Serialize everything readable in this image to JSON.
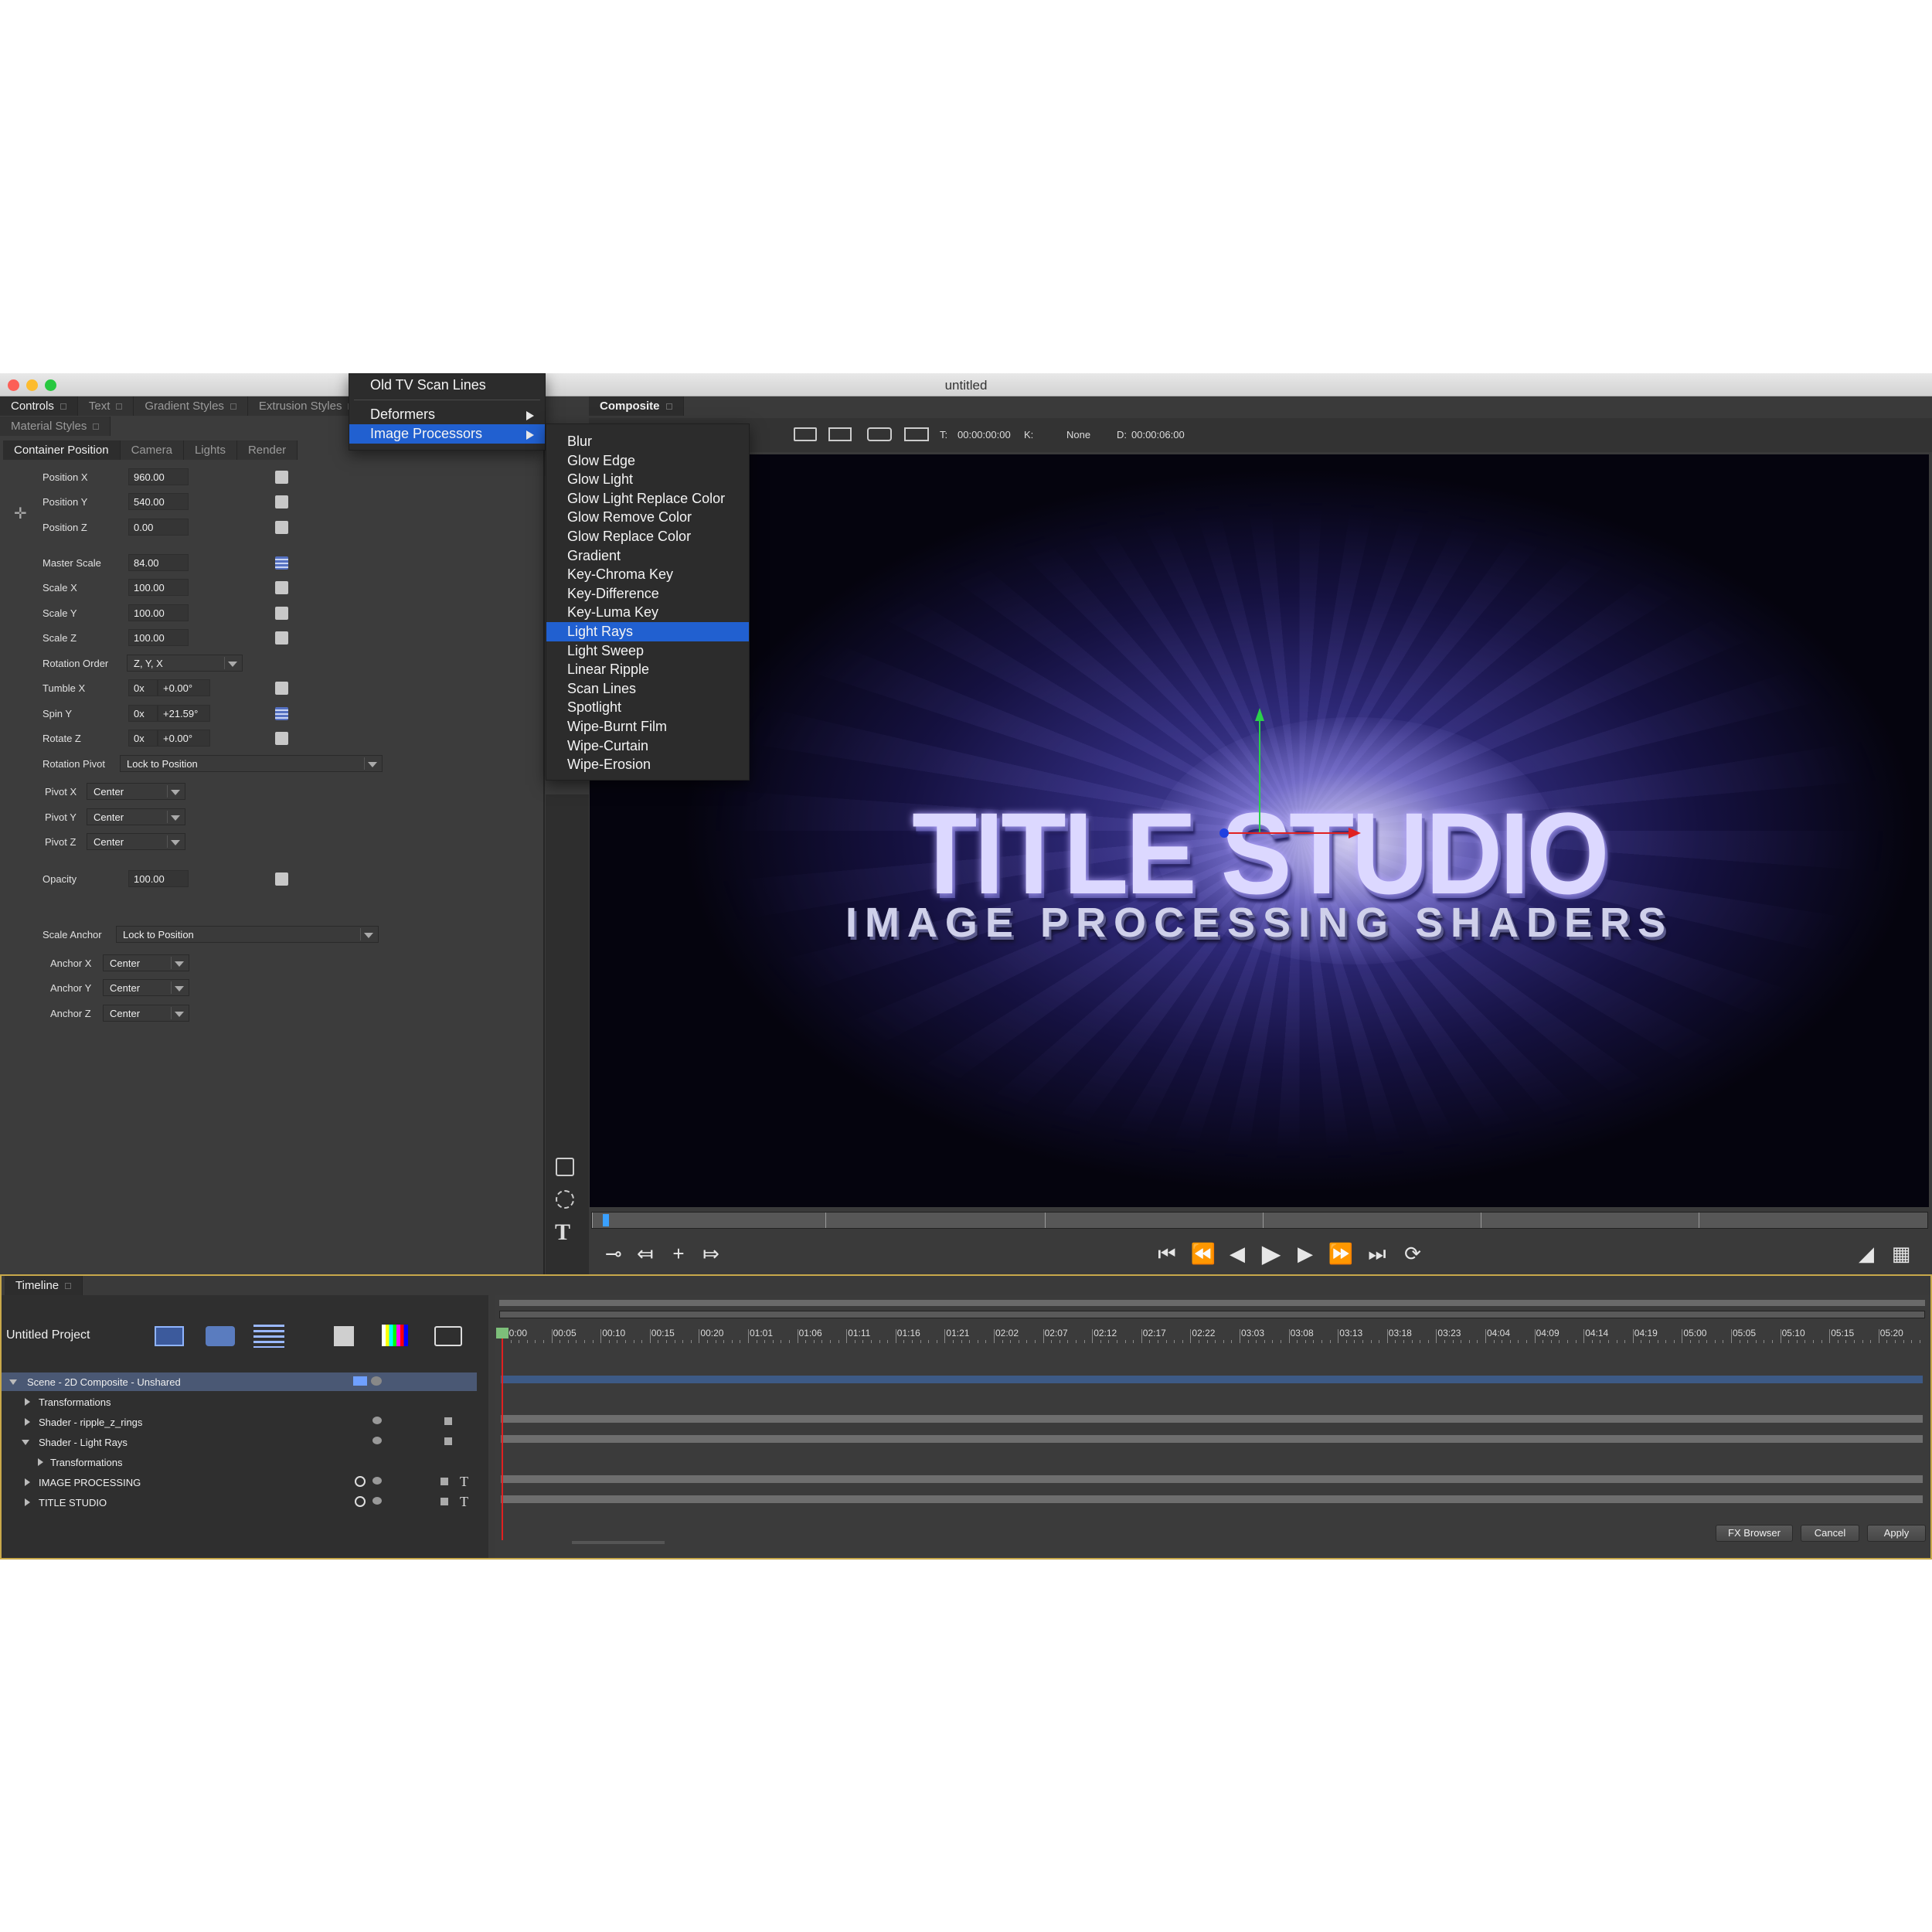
{
  "window": {
    "title": "untitled"
  },
  "left_panel": {
    "tabs_row1": [
      "Controls",
      "Text",
      "Gradient Styles",
      "Extrusion Styles"
    ],
    "tabs_row2": [
      "Material Styles"
    ],
    "sub_tabs": [
      "Container Position",
      "Camera",
      "Lights",
      "Render"
    ],
    "fields": {
      "position_x": {
        "label": "Position X",
        "value": "960.00"
      },
      "position_y": {
        "label": "Position Y",
        "value": "540.00"
      },
      "position_z": {
        "label": "Position Z",
        "value": "0.00"
      },
      "master_scale": {
        "label": "Master Scale",
        "value": "84.00"
      },
      "scale_x": {
        "label": "Scale X",
        "value": "100.00"
      },
      "scale_y": {
        "label": "Scale Y",
        "value": "100.00"
      },
      "scale_z": {
        "label": "Scale Z",
        "value": "100.00"
      },
      "rotation_order": {
        "label": "Rotation Order",
        "value": "Z, Y, X"
      },
      "tumble_x": {
        "label": "Tumble X",
        "turns": "0x",
        "value": "+0.00°"
      },
      "spin_y": {
        "label": "Spin Y",
        "turns": "0x",
        "value": "+21.59°"
      },
      "rotate_z": {
        "label": "Rotate Z",
        "turns": "0x",
        "value": "+0.00°"
      },
      "rotation_pivot": {
        "label": "Rotation Pivot",
        "value": "Lock to Position"
      },
      "pivot_x": {
        "label": "Pivot X",
        "value": "Center"
      },
      "pivot_y": {
        "label": "Pivot Y",
        "value": "Center"
      },
      "pivot_z": {
        "label": "Pivot Z",
        "value": "Center"
      },
      "opacity": {
        "label": "Opacity",
        "value": "100.00"
      },
      "scale_anchor": {
        "label": "Scale Anchor",
        "value": "Lock to Position"
      },
      "anchor_x": {
        "label": "Anchor X",
        "value": "Center"
      },
      "anchor_y": {
        "label": "Anchor Y",
        "value": "Center"
      },
      "anchor_z": {
        "label": "Anchor Z",
        "value": "Center"
      }
    }
  },
  "menu_top": {
    "items": [
      "Old TV Scan Lines",
      "Deformers",
      "Image Processors"
    ],
    "highlighted": "Image Processors"
  },
  "menu_sub": {
    "items": [
      "Blur",
      "Glow Edge",
      "Glow Light",
      "Glow Light Replace Color",
      "Glow Remove Color",
      "Glow Replace Color",
      "Gradient",
      "Key-Chroma Key",
      "Key-Difference",
      "Key-Luma Key",
      "Light Rays",
      "Light Sweep",
      "Linear Ripple",
      "Scan Lines",
      "Spotlight",
      "Wipe-Burnt Film",
      "Wipe-Curtain",
      "Wipe-Erosion"
    ],
    "highlighted": "Light Rays"
  },
  "composite": {
    "tab": "Composite",
    "time_label": "T:",
    "time_value": "00:00:00:00",
    "key_label": "K:",
    "key_value": "None",
    "duration_label": "D:",
    "duration_value": "00:00:06:00",
    "preview_title": "TITLE STUDIO",
    "preview_subtitle": "IMAGE PROCESSING SHADERS"
  },
  "timeline": {
    "tab": "Timeline",
    "project": "Untitled Project",
    "ruler": [
      "00:00",
      "00:05",
      "00:10",
      "00:15",
      "00:20",
      "01:01",
      "01:06",
      "01:11",
      "01:16",
      "01:21",
      "02:02",
      "02:07",
      "02:12",
      "02:17",
      "02:22",
      "03:03",
      "03:08",
      "03:13",
      "03:18",
      "03:23",
      "04:04",
      "04:09",
      "04:14",
      "04:19",
      "05:00",
      "05:05",
      "05:10",
      "05:15",
      "05:20"
    ],
    "layers": [
      {
        "label": "Scene - 2D Composite - Unshared"
      },
      {
        "label": "Transformations"
      },
      {
        "label": "Shader - ripple_z_rings"
      },
      {
        "label": "Shader - Light Rays"
      },
      {
        "label": "Transformations"
      },
      {
        "label": "IMAGE PROCESSING"
      },
      {
        "label": "TITLE STUDIO"
      }
    ],
    "buttons": {
      "fx_browser": "FX Browser",
      "cancel": "Cancel",
      "apply": "Apply"
    }
  },
  "colors": {
    "highlight": "#2160d0",
    "timeline_border": "#c8a84a",
    "playhead": "#e02020"
  },
  "icons": [
    "close-icon",
    "minimize-icon",
    "zoom-icon",
    "move-icon",
    "play-icon",
    "pause-icon",
    "go-to-start-icon",
    "rewind-icon",
    "step-back-icon",
    "step-forward-icon",
    "fast-forward-icon",
    "go-to-end-icon",
    "loop-icon",
    "key-icon",
    "rectangle-tool-icon",
    "ellipse-tool-icon",
    "text-tool-icon",
    "eye-icon",
    "lock-icon",
    "folder-icon"
  ]
}
